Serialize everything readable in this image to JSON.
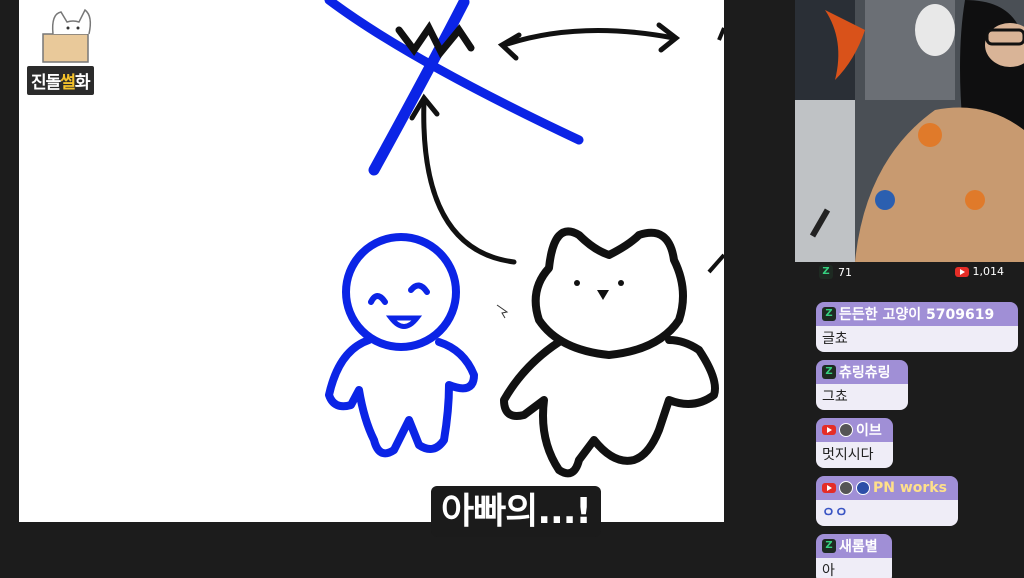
{
  "logo": {
    "text_plain": "진돌",
    "text_highlight": "썰",
    "text_end": "화"
  },
  "stats": {
    "zz_count": "71",
    "youtube_count": "1,014"
  },
  "chat": [
    {
      "source": "chzzk",
      "name": "든든한 고양이 5709619",
      "text": "글쵸"
    },
    {
      "source": "chzzk",
      "name": "츄링츄링",
      "text": "그쵸"
    },
    {
      "source": "youtube",
      "name": "이브",
      "text": "멋지시다"
    },
    {
      "source": "youtube",
      "name": "PN works",
      "text": "ㅇㅇ"
    },
    {
      "source": "chzzk",
      "name": "새롬별",
      "text": "아"
    }
  ],
  "subtitle": "아빠의...!",
  "colors": {
    "name_bar": "#a08fd6",
    "message_bg": "#efedf7",
    "drawing_blue": "#0b24e6",
    "background": "#1c1c1c"
  }
}
